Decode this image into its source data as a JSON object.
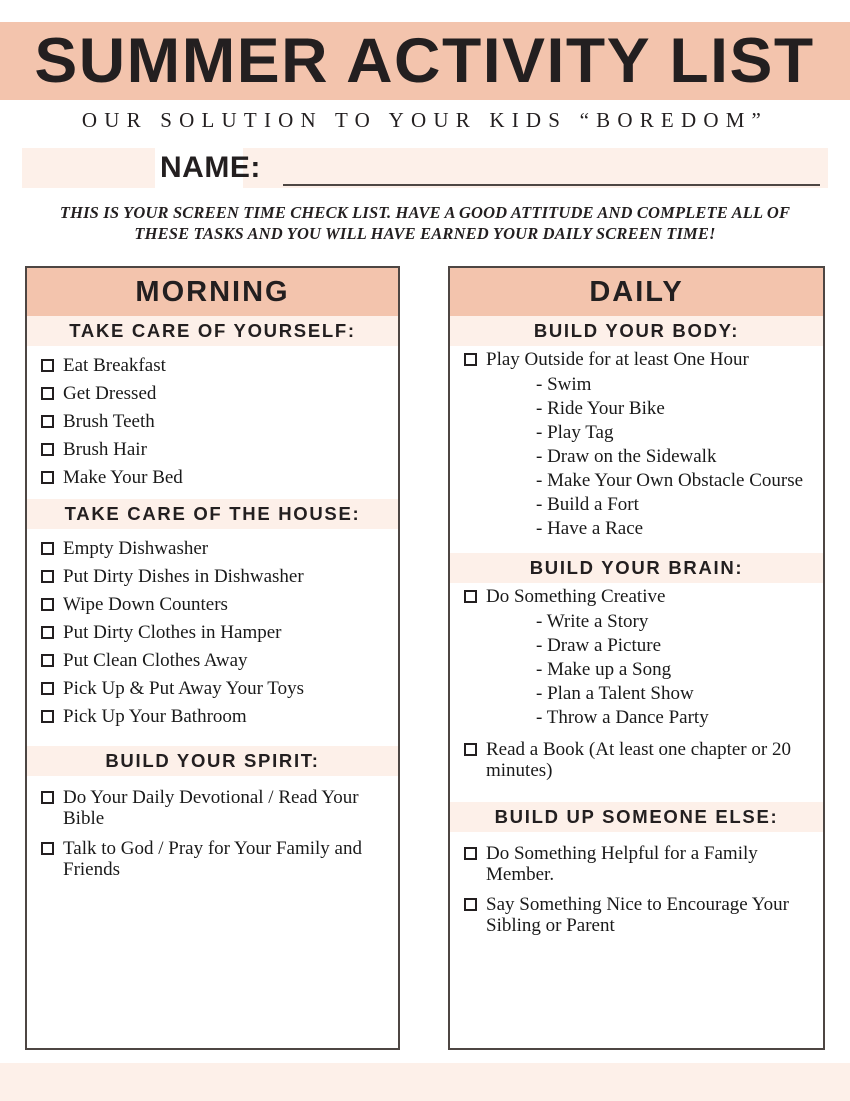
{
  "header": {
    "title": "SUMMER ACTIVITY LIST",
    "subtitle": "OUR SOLUTION TO YOUR KIDS “BOREDOM”",
    "name_label": "NAME:",
    "name_value": "",
    "instructions": "THIS IS YOUR SCREEN TIME CHECK LIST. HAVE A GOOD ATTITUDE AND COMPLETE ALL OF THESE TASKS AND YOU WILL HAVE EARNED YOUR DAILY SCREEN TIME!"
  },
  "colors": {
    "band_peach": "#f3c4ad",
    "band_cream": "#fdf0e9",
    "ink": "#231f20",
    "border": "#4d4643"
  },
  "columns": [
    {
      "title": "MORNING",
      "sections": [
        {
          "heading": "TAKE CARE OF YOURSELF:",
          "items": [
            {
              "label": "Eat Breakfast"
            },
            {
              "label": "Get Dressed"
            },
            {
              "label": "Brush Teeth"
            },
            {
              "label": "Brush Hair"
            },
            {
              "label": "Make Your Bed"
            }
          ]
        },
        {
          "heading": "TAKE CARE OF THE HOUSE:",
          "items": [
            {
              "label": "Empty Dishwasher"
            },
            {
              "label": "Put Dirty Dishes in Dishwasher"
            },
            {
              "label": "Wipe Down Counters"
            },
            {
              "label": "Put Dirty Clothes in Hamper"
            },
            {
              "label": "Put Clean Clothes Away"
            },
            {
              "label": "Pick Up & Put Away Your Toys"
            },
            {
              "label": "Pick Up Your Bathroom"
            }
          ]
        },
        {
          "heading": "BUILD YOUR SPIRIT:",
          "items": [
            {
              "label": "Do Your Daily Devotional / Read Your Bible"
            },
            {
              "label": "Talk to God / Pray for Your Family and Friends"
            }
          ]
        }
      ]
    },
    {
      "title": "DAILY",
      "sections": [
        {
          "heading": "BUILD YOUR BODY:",
          "items": [
            {
              "label": "Play Outside for at least One Hour",
              "subitems": [
                "- Swim",
                "- Ride Your Bike",
                "- Play Tag",
                "- Draw on the Sidewalk",
                "- Make Your Own Obstacle Course",
                "- Build a Fort",
                "- Have a Race"
              ]
            }
          ]
        },
        {
          "heading": "BUILD YOUR BRAIN:",
          "items": [
            {
              "label": "Do Something Creative",
              "subitems": [
                "- Write a Story",
                "- Draw a Picture",
                "- Make up a Song",
                "- Plan a Talent Show",
                "- Throw a Dance Party"
              ]
            },
            {
              "label": "Read a Book (At least one chapter or 20 minutes)"
            }
          ]
        },
        {
          "heading": "BUILD UP SOMEONE ELSE:",
          "items": [
            {
              "label": "Do Something Helpful for a Family Member."
            },
            {
              "label": "Say Something Nice to Encourage Your Sibling or Parent"
            }
          ]
        }
      ]
    }
  ]
}
